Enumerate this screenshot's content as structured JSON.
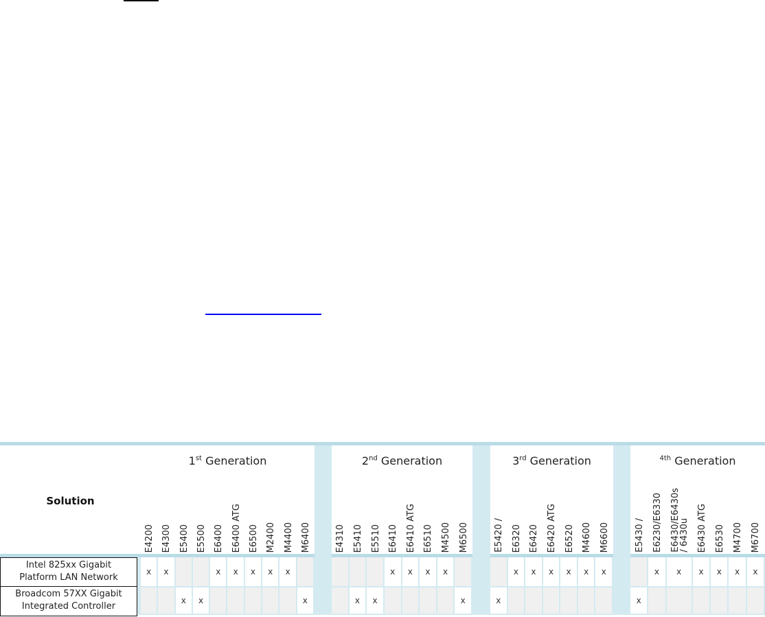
{
  "decorations": {
    "top_rule_color": "#000000",
    "link_underline_color": "#0000ff"
  },
  "table": {
    "solution_header": "Solution",
    "border_color": "#b9dce6",
    "rows": [
      {
        "label_line1": "Intel 825xx Gigabit",
        "label_line2": "Platform LAN Network"
      },
      {
        "label_line1": "Broadcom 57XX Gigabit",
        "label_line2": "Integrated Controller"
      }
    ],
    "generations": [
      {
        "num": "1",
        "suffix": "st",
        "title": "Generation",
        "models": [
          "E4200",
          "E4300",
          "E5400",
          "E5500",
          "E6400",
          "E6400 ATG",
          "E6500",
          "M2400",
          "M4400",
          "M6400"
        ],
        "row_values": [
          [
            "x",
            "x",
            "",
            "",
            "x",
            "x",
            "x",
            "x",
            "x",
            ""
          ],
          [
            "",
            "",
            "x",
            "x",
            "",
            "",
            "",
            "",
            "",
            "x"
          ]
        ]
      },
      {
        "num": "2",
        "suffix": "nd",
        "title": "Generation",
        "models": [
          "E4310",
          "E5410",
          "E5510",
          "E6410",
          "E6410 ATG",
          "E6510",
          "M4500",
          "M6500"
        ],
        "row_values": [
          [
            "",
            "",
            "",
            "x",
            "x",
            "x",
            "x",
            ""
          ],
          [
            "",
            "x",
            "x",
            "",
            "",
            "",
            "",
            "x"
          ]
        ]
      },
      {
        "num": "3",
        "suffix": "rd",
        "title": "Generation",
        "models": [
          "E5420 /",
          "E6320",
          "E6420",
          "E6420 ATG",
          "E6520",
          "M4600",
          "M6600"
        ],
        "row_values": [
          [
            "",
            "x",
            "x",
            "x",
            "x",
            "x",
            "x"
          ],
          [
            "x",
            "",
            "",
            "",
            "",
            "",
            ""
          ]
        ]
      },
      {
        "num": "",
        "suffix": "4th",
        "title": "Generation",
        "models": [
          "E5430 /",
          "E6230/E6330",
          "E6430/E6430s\n/ 6430u",
          "E6430 ATG",
          "E6530",
          "M4700",
          "M6700"
        ],
        "row_values": [
          [
            "",
            "x",
            "x",
            "x",
            "x",
            "x",
            "x"
          ],
          [
            "x",
            "",
            "",
            "",
            "",
            "",
            ""
          ]
        ]
      }
    ]
  }
}
